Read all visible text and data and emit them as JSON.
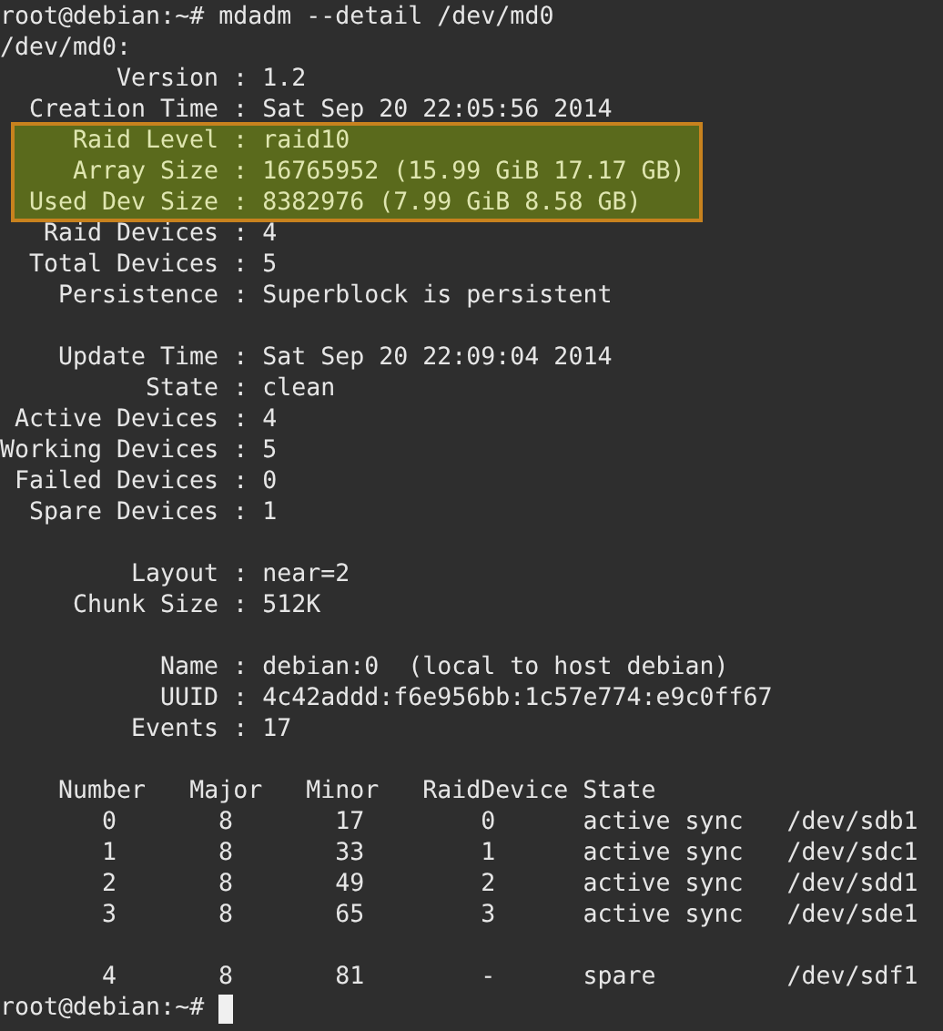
{
  "terminal": {
    "lines": [
      {
        "kind": "command",
        "prompt": "root@debian:~#",
        "text": "mdadm --detail /dev/md0"
      },
      {
        "kind": "text",
        "text": "/dev/md0:"
      },
      {
        "kind": "field",
        "label": "Version :",
        "value": "1.2"
      },
      {
        "kind": "field",
        "label": "Creation Time :",
        "value": "Sat Sep 20 22:05:56 2014"
      },
      {
        "kind": "highlight",
        "fields": [
          {
            "label": "Raid Level :",
            "value": "raid10"
          },
          {
            "label": "Array Size :",
            "value": "16765952 (15.99 GiB 17.17 GB)"
          },
          {
            "label": "Used Dev Size :",
            "value": "8382976 (7.99 GiB 8.58 GB)"
          }
        ]
      },
      {
        "kind": "field",
        "label": "Raid Devices :",
        "value": "4"
      },
      {
        "kind": "field",
        "label": "Total Devices :",
        "value": "5"
      },
      {
        "kind": "field",
        "label": "Persistence :",
        "value": "Superblock is persistent"
      },
      {
        "kind": "blank"
      },
      {
        "kind": "field",
        "label": "Update Time :",
        "value": "Sat Sep 20 22:09:04 2014"
      },
      {
        "kind": "field",
        "label": "State :",
        "value": "clean"
      },
      {
        "kind": "field",
        "label": "Active Devices :",
        "value": "4"
      },
      {
        "kind": "field",
        "label": "Working Devices :",
        "value": "5"
      },
      {
        "kind": "field",
        "label": "Failed Devices :",
        "value": "0"
      },
      {
        "kind": "field",
        "label": "Spare Devices :",
        "value": "1"
      },
      {
        "kind": "blank"
      },
      {
        "kind": "field",
        "label": "Layout :",
        "value": "near=2"
      },
      {
        "kind": "field",
        "label": "Chunk Size :",
        "value": "512K"
      },
      {
        "kind": "blank"
      },
      {
        "kind": "field",
        "label": "Name :",
        "value": "debian:0  (local to host debian)"
      },
      {
        "kind": "field",
        "label": "UUID :",
        "value": "4c42addd:f6e956bb:1c57e774:e9c0ff67"
      },
      {
        "kind": "field",
        "label": "Events :",
        "value": "17"
      },
      {
        "kind": "blank"
      },
      {
        "kind": "table_header",
        "cells": [
          "Number",
          "Major",
          "Minor",
          "RaidDevice",
          "State"
        ]
      },
      {
        "kind": "table_row",
        "cells": [
          "0",
          "8",
          "17",
          "0",
          "active sync",
          "/dev/sdb1"
        ]
      },
      {
        "kind": "table_row",
        "cells": [
          "1",
          "8",
          "33",
          "1",
          "active sync",
          "/dev/sdc1"
        ]
      },
      {
        "kind": "table_row",
        "cells": [
          "2",
          "8",
          "49",
          "2",
          "active sync",
          "/dev/sdd1"
        ]
      },
      {
        "kind": "table_row",
        "cells": [
          "3",
          "8",
          "65",
          "3",
          "active sync",
          "/dev/sde1"
        ]
      },
      {
        "kind": "blank"
      },
      {
        "kind": "table_row",
        "cells": [
          "4",
          "8",
          "81",
          "-",
          "spare",
          "/dev/sdf1"
        ]
      },
      {
        "kind": "prompt",
        "prompt": "root@debian:~#"
      }
    ]
  }
}
